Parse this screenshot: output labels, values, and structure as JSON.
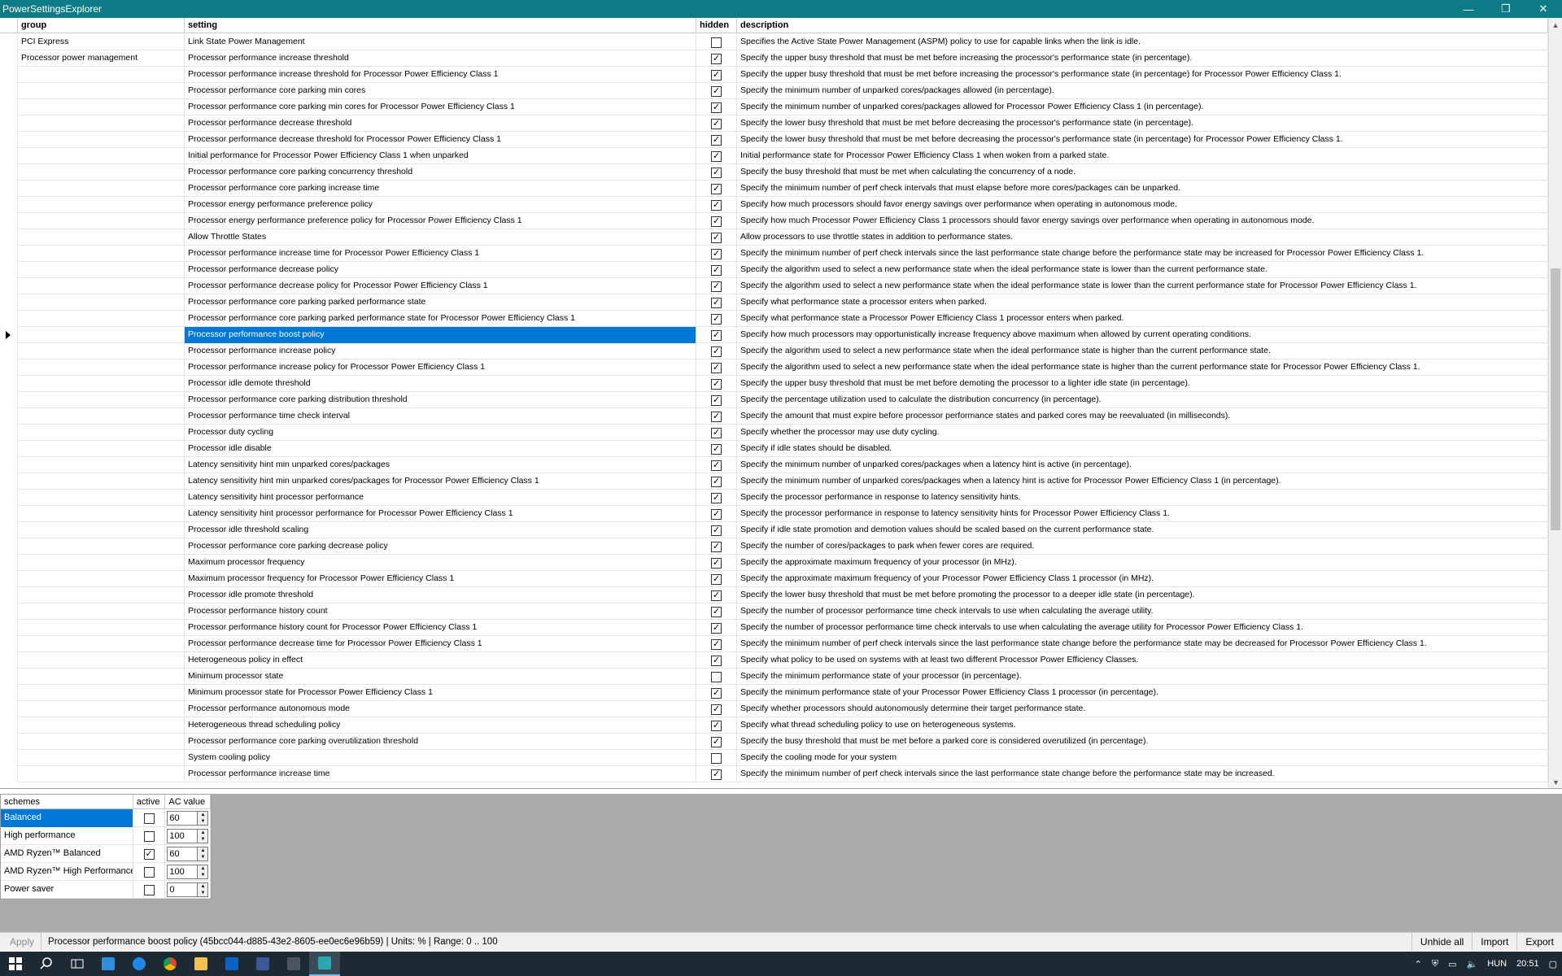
{
  "window": {
    "title": "PowerSettingsExplorer",
    "minimize": "—",
    "restore": "❐",
    "close": "✕"
  },
  "grid": {
    "columns": {
      "group": "group",
      "setting": "setting",
      "hidden": "hidden",
      "description": "description"
    },
    "selected_index": 18,
    "rows": [
      {
        "group": "PCI Express",
        "setting": "Link State Power Management",
        "hidden": false,
        "description": "Specifies the Active State Power Management (ASPM) policy to use for capable links when the link is idle."
      },
      {
        "group": "Processor power management",
        "setting": "Processor performance increase threshold",
        "hidden": true,
        "description": "Specify the upper busy threshold that must be met before increasing the processor's performance state (in percentage)."
      },
      {
        "group": "",
        "setting": "Processor performance increase threshold for Processor Power Efficiency Class 1",
        "hidden": true,
        "description": "Specify the upper busy threshold that must be met before increasing the processor's performance state (in percentage) for Processor Power Efficiency Class 1."
      },
      {
        "group": "",
        "setting": "Processor performance core parking min cores",
        "hidden": true,
        "description": "Specify the minimum number of unparked cores/packages allowed (in percentage)."
      },
      {
        "group": "",
        "setting": "Processor performance core parking min cores for Processor Power Efficiency Class 1",
        "hidden": true,
        "description": "Specify the minimum number of unparked cores/packages allowed for Processor Power Efficiency Class 1 (in percentage)."
      },
      {
        "group": "",
        "setting": "Processor performance decrease threshold",
        "hidden": true,
        "description": "Specify the lower busy threshold that must be met before decreasing the processor's performance state (in percentage)."
      },
      {
        "group": "",
        "setting": "Processor performance decrease threshold for Processor Power Efficiency Class 1",
        "hidden": true,
        "description": "Specify the lower busy threshold that must be met before decreasing the processor's performance state (in percentage) for Processor Power Efficiency Class 1."
      },
      {
        "group": "",
        "setting": "Initial performance for Processor Power Efficiency Class 1 when unparked",
        "hidden": true,
        "description": "Initial performance state for Processor Power Efficiency Class 1 when woken from a parked state."
      },
      {
        "group": "",
        "setting": "Processor performance core parking concurrency threshold",
        "hidden": true,
        "description": "Specify the busy threshold that must be met when calculating the concurrency of a node."
      },
      {
        "group": "",
        "setting": "Processor performance core parking increase time",
        "hidden": true,
        "description": "Specify the minimum number of perf check intervals that must elapse before more cores/packages can be unparked."
      },
      {
        "group": "",
        "setting": "Processor energy performance preference policy",
        "hidden": true,
        "description": "Specify how much processors should favor energy savings over performance when operating in autonomous mode."
      },
      {
        "group": "",
        "setting": "Processor energy performance preference policy for Processor Power Efficiency Class 1",
        "hidden": true,
        "description": "Specify how much Processor Power Efficiency Class 1 processors should favor energy savings over performance when operating in autonomous mode."
      },
      {
        "group": "",
        "setting": "Allow Throttle States",
        "hidden": true,
        "description": "Allow processors to use throttle states in addition to performance states."
      },
      {
        "group": "",
        "setting": "Processor performance increase time for Processor Power Efficiency Class 1",
        "hidden": true,
        "description": "Specify the minimum number of perf check intervals since the last performance state change before the performance state may be increased for Processor Power Efficiency Class 1."
      },
      {
        "group": "",
        "setting": "Processor performance decrease policy",
        "hidden": true,
        "description": "Specify the algorithm used to select a new performance state when the ideal performance state is lower than the current performance state."
      },
      {
        "group": "",
        "setting": "Processor performance decrease policy for Processor Power Efficiency Class 1",
        "hidden": true,
        "description": "Specify the algorithm used to select a new performance state when the ideal performance state is lower than the current performance state for Processor Power Efficiency Class 1."
      },
      {
        "group": "",
        "setting": "Processor performance core parking parked performance state",
        "hidden": true,
        "description": "Specify what performance state a processor enters when parked."
      },
      {
        "group": "",
        "setting": "Processor performance core parking parked performance state for Processor Power Efficiency Class 1",
        "hidden": true,
        "description": "Specify what performance state a Processor Power Efficiency Class 1 processor enters when parked."
      },
      {
        "group": "",
        "setting": "Processor performance boost policy",
        "hidden": true,
        "description": "Specify how much processors may opportunistically increase frequency above maximum when allowed by current operating conditions."
      },
      {
        "group": "",
        "setting": "Processor performance increase policy",
        "hidden": true,
        "description": "Specify the algorithm used to select a new performance state when the ideal performance state is higher than the current performance state."
      },
      {
        "group": "",
        "setting": "Processor performance increase policy for Processor Power Efficiency Class 1",
        "hidden": true,
        "description": "Specify the algorithm used to select a new performance state when the ideal performance state is higher than the current performance state for Processor Power Efficiency Class 1."
      },
      {
        "group": "",
        "setting": "Processor idle demote threshold",
        "hidden": true,
        "description": "Specify the upper busy threshold that must be met before demoting the processor to a lighter idle state (in percentage)."
      },
      {
        "group": "",
        "setting": "Processor performance core parking distribution threshold",
        "hidden": true,
        "description": "Specify the percentage utilization used to calculate the distribution concurrency (in percentage)."
      },
      {
        "group": "",
        "setting": "Processor performance time check interval",
        "hidden": true,
        "description": "Specify the amount that must expire before processor performance states and parked cores may be reevaluated (in milliseconds)."
      },
      {
        "group": "",
        "setting": "Processor duty cycling",
        "hidden": true,
        "description": "Specify whether the processor may use duty cycling."
      },
      {
        "group": "",
        "setting": "Processor idle disable",
        "hidden": true,
        "description": "Specify if idle states should be disabled."
      },
      {
        "group": "",
        "setting": "Latency sensitivity hint min unparked cores/packages",
        "hidden": true,
        "description": "Specify the minimum number of unparked cores/packages when a latency hint is active (in percentage)."
      },
      {
        "group": "",
        "setting": "Latency sensitivity hint min unparked cores/packages for Processor Power Efficiency Class 1",
        "hidden": true,
        "description": "Specify the minimum number of unparked cores/packages when a latency hint is active for Processor Power Efficiency Class 1 (in percentage)."
      },
      {
        "group": "",
        "setting": "Latency sensitivity hint processor performance",
        "hidden": true,
        "description": "Specify the processor performance in response to latency sensitivity hints."
      },
      {
        "group": "",
        "setting": "Latency sensitivity hint processor performance for Processor Power Efficiency Class 1",
        "hidden": true,
        "description": "Specify the processor performance in response to latency sensitivity hints for Processor Power Efficiency Class 1."
      },
      {
        "group": "",
        "setting": "Processor idle threshold scaling",
        "hidden": true,
        "description": "Specify if idle state promotion and demotion values should be scaled based on the current performance state."
      },
      {
        "group": "",
        "setting": "Processor performance core parking decrease policy",
        "hidden": true,
        "description": "Specify the number of cores/packages to park when fewer cores are required."
      },
      {
        "group": "",
        "setting": "Maximum processor frequency",
        "hidden": true,
        "description": "Specify the approximate maximum frequency of your processor (in MHz)."
      },
      {
        "group": "",
        "setting": "Maximum processor frequency for Processor Power Efficiency Class 1",
        "hidden": true,
        "description": "Specify the approximate maximum frequency of your Processor Power Efficiency Class 1 processor (in MHz)."
      },
      {
        "group": "",
        "setting": "Processor idle promote threshold",
        "hidden": true,
        "description": "Specify the lower busy threshold that must be met before promoting the processor to a deeper idle state (in percentage)."
      },
      {
        "group": "",
        "setting": "Processor performance history count",
        "hidden": true,
        "description": "Specify the number of processor performance time check intervals to use when calculating the average utility."
      },
      {
        "group": "",
        "setting": "Processor performance history count for Processor Power Efficiency Class 1",
        "hidden": true,
        "description": "Specify the number of processor performance time check intervals to use when calculating the average utility for Processor Power Efficiency Class 1."
      },
      {
        "group": "",
        "setting": "Processor performance decrease time for Processor Power Efficiency Class 1",
        "hidden": true,
        "description": "Specify the minimum number of perf check intervals since the last performance state change before the performance state may be decreased for Processor Power Efficiency Class 1."
      },
      {
        "group": "",
        "setting": "Heterogeneous policy in effect",
        "hidden": true,
        "description": "Specify what policy to be used on systems with at least two different Processor Power Efficiency Classes."
      },
      {
        "group": "",
        "setting": "Minimum processor state",
        "hidden": false,
        "description": "Specify the minimum performance state of your processor (in percentage)."
      },
      {
        "group": "",
        "setting": "Minimum processor state for Processor Power Efficiency Class 1",
        "hidden": true,
        "description": "Specify the minimum performance state of your Processor Power Efficiency Class 1 processor (in percentage)."
      },
      {
        "group": "",
        "setting": "Processor performance autonomous mode",
        "hidden": true,
        "description": "Specify whether processors should autonomously determine their target performance state."
      },
      {
        "group": "",
        "setting": "Heterogeneous thread scheduling policy",
        "hidden": true,
        "description": "Specify what thread scheduling policy to use on heterogeneous systems."
      },
      {
        "group": "",
        "setting": "Processor performance core parking overutilization threshold",
        "hidden": true,
        "description": "Specify the busy threshold that must be met before a parked core is considered overutilized (in percentage)."
      },
      {
        "group": "",
        "setting": "System cooling policy",
        "hidden": false,
        "description": "Specify the cooling mode for your system"
      },
      {
        "group": "",
        "setting": "Processor performance increase time",
        "hidden": true,
        "description": "Specify the minimum number of perf check intervals since the last performance state change before the performance state may be increased."
      }
    ]
  },
  "schemes": {
    "columns": {
      "name": "schemes",
      "active": "active",
      "ac_value": "AC value"
    },
    "selected_index": 0,
    "rows": [
      {
        "name": "Balanced",
        "active": false,
        "ac_value": "60"
      },
      {
        "name": "High performance",
        "active": false,
        "ac_value": "100"
      },
      {
        "name": "AMD Ryzen™ Balanced",
        "active": true,
        "ac_value": "60"
      },
      {
        "name": "AMD Ryzen™ High Performance",
        "active": false,
        "ac_value": "100"
      },
      {
        "name": "Power saver",
        "active": false,
        "ac_value": "0"
      }
    ]
  },
  "status": {
    "apply": "Apply",
    "info": "Processor performance boost policy (45bcc044-d885-43e2-8605-ee0ec6e96b59) | Units: % | Range: 0 .. 100",
    "unhide_all": "Unhide all",
    "import": "Import",
    "export": "Export"
  },
  "taskbar": {
    "icons": [
      "windows-start-icon",
      "search-icon",
      "task-view-icon",
      "store-icon",
      "edge-icon",
      "chrome-icon",
      "file-explorer-icon",
      "outlook-icon",
      "app-icon",
      "calculator-icon",
      "power-settings-app-icon"
    ],
    "language": "HUN",
    "time": "20:51"
  },
  "colors": {
    "titlebar": "#0e7c86",
    "selection": "#0078d7",
    "taskbar": "#1e2a33"
  }
}
